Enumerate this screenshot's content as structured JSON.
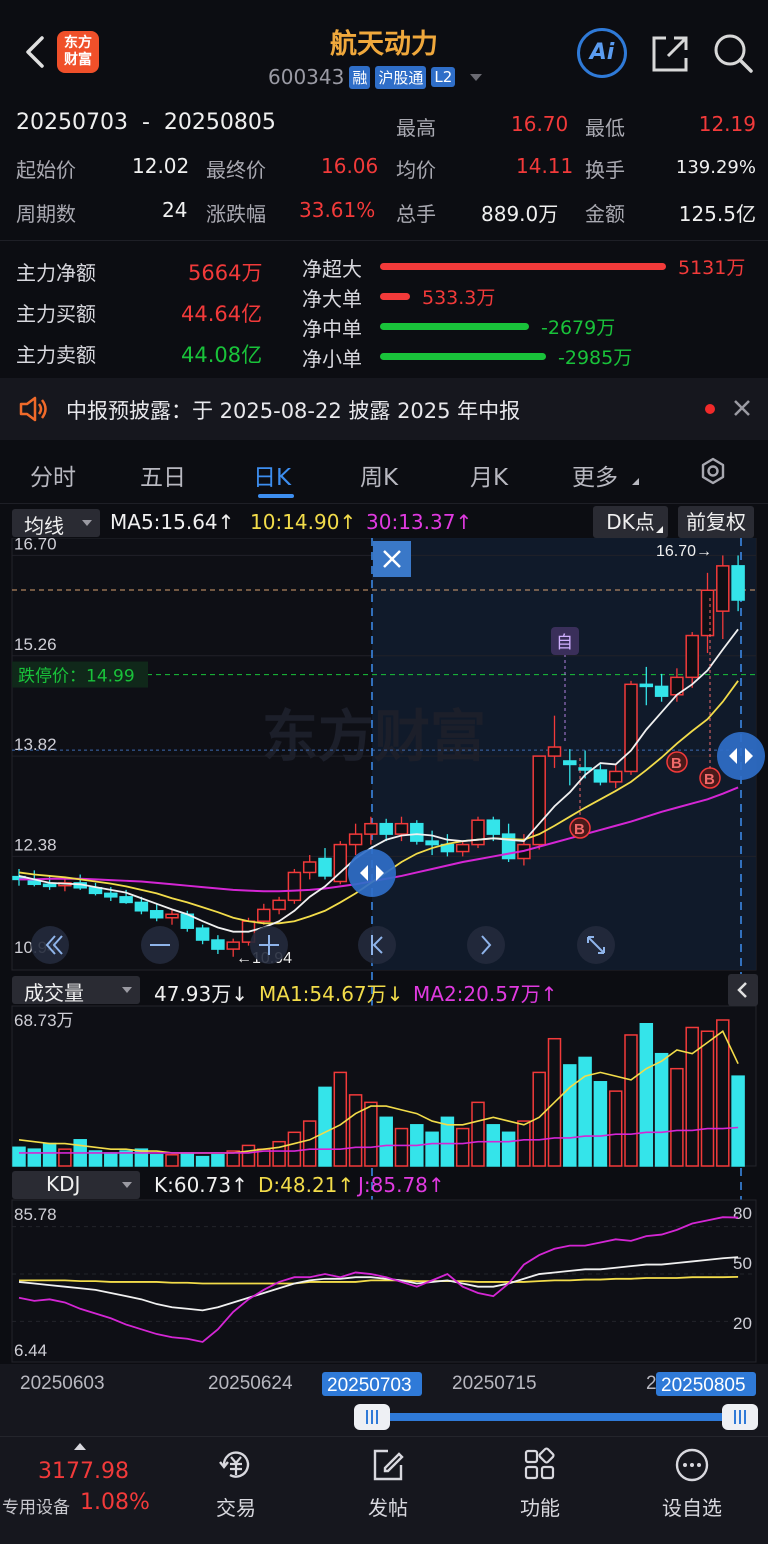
{
  "header": {
    "title": "航天动力",
    "code": "600343",
    "badge_rong": "融",
    "badge_hgt": "沪股通",
    "badge_l2": "L2",
    "logo_text_1": "东方",
    "logo_text_2": "财富",
    "ai_label": "Ai"
  },
  "range": {
    "label": "20250703  -  20250805"
  },
  "stats": {
    "high_label": "最高",
    "high": "16.70",
    "low_label": "最低",
    "low": "12.19",
    "start_label": "起始价",
    "start": "12.02",
    "end_label": "最终价",
    "end": "16.06",
    "avg_label": "均价",
    "avg": "14.11",
    "turnover_label": "换手",
    "turnover": "139.29%",
    "periods_label": "周期数",
    "periods": "24",
    "change_label": "涨跌幅",
    "change": "33.61%",
    "vol_label": "总手",
    "vol": "889.0万",
    "amount_label": "金额",
    "amount": "125.5亿"
  },
  "fund": {
    "net_label": "主力净额",
    "net": "5664万",
    "buy_label": "主力买额",
    "buy": "44.64亿",
    "sell_label": "主力卖额",
    "sell": "44.08亿",
    "flows": [
      {
        "label": "净超大",
        "value": "5131万",
        "ratio": 1.0,
        "color": "#f23a3a"
      },
      {
        "label": "净大单",
        "value": "533.3万",
        "ratio": 0.104,
        "color": "#f23a3a"
      },
      {
        "label": "净中单",
        "value": "-2679万",
        "ratio": 0.52,
        "color": "#19c23a"
      },
      {
        "label": "净小单",
        "value": "-2985万",
        "ratio": 0.58,
        "color": "#19c23a"
      }
    ]
  },
  "notice": {
    "text": "中报预披露：于 2025-08-22 披露 2025 年中报"
  },
  "tabs": [
    "分时",
    "五日",
    "日K",
    "周K",
    "月K",
    "更多"
  ],
  "ma": {
    "selector": "均线",
    "ma5": "MA5:15.64",
    "ma10": "10:14.90",
    "ma30": "30:13.37",
    "dk": "DK点",
    "fq": "前复权"
  },
  "price_axis": {
    "p1": "16.70",
    "p2": "15.26",
    "p3": "13.82",
    "p4": "12.38",
    "p5": "10.94",
    "limit": "跌停价：14.99",
    "max_mark": "16.70",
    "min_mark": "10.94",
    "zi": "自",
    "b": "B"
  },
  "volume": {
    "selector": "成交量",
    "v": "47.93万",
    "ma1": "MA1:54.67万",
    "ma2": "MA2:20.57万",
    "top": "68.73万"
  },
  "kdj": {
    "selector": "KDJ",
    "k": "K:60.73",
    "d": "D:48.21",
    "j": "J:85.78",
    "top": "85.78",
    "bottom": "6.44",
    "r80": "80",
    "r50": "50",
    "r20": "20"
  },
  "dates": {
    "d1": "20250603",
    "d2": "20250624",
    "d3": "20250703",
    "d4": "20250715",
    "d5": "20250805",
    "d5_partial": "2"
  },
  "watermark": "东方财富",
  "bottom": {
    "index": "3177.98",
    "index_change": "1.08%",
    "device": "专用设备",
    "trade": "交易",
    "post": "发帖",
    "func": "功能",
    "self": "设自选"
  },
  "chart_data": {
    "type": "candlestick",
    "ohlc": [
      [
        12.09,
        12.2,
        11.96,
        12.05
      ],
      [
        12.05,
        12.18,
        11.95,
        11.98
      ],
      [
        11.98,
        12.1,
        11.9,
        11.95
      ],
      [
        11.96,
        12.05,
        11.88,
        12.0
      ],
      [
        12.0,
        12.12,
        11.9,
        11.93
      ],
      [
        11.93,
        12.0,
        11.82,
        11.85
      ],
      [
        11.85,
        11.94,
        11.74,
        11.8
      ],
      [
        11.8,
        11.9,
        11.7,
        11.72
      ],
      [
        11.72,
        11.8,
        11.55,
        11.6
      ],
      [
        11.6,
        11.7,
        11.45,
        11.5
      ],
      [
        11.5,
        11.62,
        11.4,
        11.55
      ],
      [
        11.55,
        11.6,
        11.3,
        11.35
      ],
      [
        11.35,
        11.4,
        11.12,
        11.18
      ],
      [
        11.18,
        11.25,
        10.98,
        11.05
      ],
      [
        11.05,
        11.2,
        10.94,
        11.15
      ],
      [
        11.15,
        11.5,
        11.1,
        11.45
      ],
      [
        11.45,
        11.7,
        11.4,
        11.62
      ],
      [
        11.62,
        11.8,
        11.55,
        11.75
      ],
      [
        11.75,
        12.2,
        11.7,
        12.15
      ],
      [
        12.15,
        12.4,
        12.05,
        12.3
      ],
      [
        12.35,
        12.5,
        12.05,
        12.1
      ],
      [
        12.02,
        12.6,
        11.98,
        12.55
      ],
      [
        12.55,
        12.85,
        12.4,
        12.7
      ],
      [
        12.7,
        12.95,
        12.55,
        12.85
      ],
      [
        12.85,
        12.92,
        12.6,
        12.7
      ],
      [
        12.7,
        12.95,
        12.6,
        12.85
      ],
      [
        12.85,
        12.9,
        12.55,
        12.6
      ],
      [
        12.6,
        12.75,
        12.4,
        12.55
      ],
      [
        12.55,
        12.7,
        12.38,
        12.45
      ],
      [
        12.45,
        12.6,
        12.38,
        12.55
      ],
      [
        12.55,
        12.95,
        12.5,
        12.9
      ],
      [
        12.9,
        12.95,
        12.6,
        12.7
      ],
      [
        12.7,
        12.85,
        12.3,
        12.35
      ],
      [
        12.35,
        12.7,
        12.25,
        12.55
      ],
      [
        12.55,
        13.82,
        12.48,
        13.82
      ],
      [
        13.82,
        14.4,
        13.65,
        13.95
      ],
      [
        13.75,
        13.92,
        13.4,
        13.7
      ],
      [
        13.65,
        13.9,
        13.5,
        13.62
      ],
      [
        13.62,
        13.7,
        13.4,
        13.45
      ],
      [
        13.45,
        13.7,
        13.36,
        13.6
      ],
      [
        13.6,
        14.9,
        13.55,
        14.85
      ],
      [
        14.85,
        15.1,
        14.55,
        14.82
      ],
      [
        14.82,
        15.0,
        14.6,
        14.68
      ],
      [
        14.7,
        15.08,
        14.6,
        14.95
      ],
      [
        14.95,
        15.6,
        14.8,
        15.55
      ],
      [
        15.55,
        16.45,
        15.3,
        16.2
      ],
      [
        15.9,
        16.7,
        15.5,
        16.55
      ],
      [
        16.55,
        16.7,
        15.9,
        16.06
      ]
    ],
    "ma5": [
      12.1,
      12.05,
      12.0,
      11.99,
      11.98,
      11.94,
      11.9,
      11.86,
      11.78,
      11.7,
      11.62,
      11.55,
      11.45,
      11.36,
      11.3,
      11.3,
      11.36,
      11.45,
      11.6,
      11.8,
      11.95,
      12.15,
      12.35,
      12.5,
      12.62,
      12.68,
      12.7,
      12.68,
      12.62,
      12.6,
      12.62,
      12.64,
      12.62,
      12.6,
      12.85,
      13.1,
      13.3,
      13.55,
      13.72,
      13.7,
      13.9,
      14.2,
      14.45,
      14.7,
      14.85,
      15.05,
      15.35,
      15.64
    ],
    "ma10": [
      12.15,
      12.12,
      12.1,
      12.08,
      12.05,
      12.02,
      11.99,
      11.95,
      11.9,
      11.85,
      11.78,
      11.72,
      11.65,
      11.58,
      11.5,
      11.45,
      11.42,
      11.42,
      11.45,
      11.52,
      11.6,
      11.72,
      11.85,
      12.0,
      12.15,
      12.3,
      12.42,
      12.5,
      12.56,
      12.6,
      12.62,
      12.64,
      12.63,
      12.62,
      12.7,
      12.82,
      12.95,
      13.08,
      13.2,
      13.32,
      13.45,
      13.62,
      13.8,
      14.0,
      14.18,
      14.35,
      14.6,
      14.9
    ],
    "ma30": [
      12.05,
      12.05,
      12.06,
      12.06,
      12.06,
      12.05,
      12.04,
      12.03,
      12.02,
      12.0,
      11.98,
      11.96,
      11.94,
      11.92,
      11.9,
      11.89,
      11.88,
      11.88,
      11.89,
      11.9,
      11.92,
      11.95,
      11.98,
      12.02,
      12.06,
      12.1,
      12.15,
      12.2,
      12.25,
      12.3,
      12.34,
      12.38,
      12.42,
      12.46,
      12.52,
      12.58,
      12.64,
      12.7,
      12.76,
      12.82,
      12.88,
      12.95,
      13.02,
      13.08,
      13.14,
      13.2,
      13.28,
      13.37
    ],
    "volume_wan": [
      10,
      9,
      12,
      9,
      14,
      8,
      7,
      8,
      9,
      6,
      6,
      7,
      5,
      6,
      8,
      11,
      9,
      13,
      18,
      24,
      42,
      50,
      38,
      34,
      26,
      20,
      22,
      18,
      26,
      20,
      34,
      22,
      18,
      24,
      50,
      68,
      54,
      58,
      45,
      40,
      70,
      76,
      60,
      52,
      74,
      72,
      78,
      48
    ],
    "volume_ma1": [
      14,
      13,
      12,
      12,
      11,
      10,
      9,
      9,
      8,
      8,
      7,
      7,
      7,
      7,
      7,
      8,
      9,
      10,
      12,
      14,
      18,
      22,
      28,
      32,
      32,
      30,
      28,
      24,
      22,
      22,
      24,
      26,
      24,
      22,
      26,
      34,
      42,
      48,
      50,
      48,
      46,
      52,
      56,
      62,
      60,
      66,
      72,
      54.67
    ],
    "volume_ma2": [
      7,
      7,
      7,
      7,
      7,
      7,
      7,
      7,
      7,
      7,
      7,
      7,
      7,
      7,
      7,
      7,
      8,
      8,
      8,
      9,
      9,
      9,
      10,
      10,
      11,
      11,
      11,
      12,
      12,
      12,
      13,
      13,
      13,
      14,
      14,
      15,
      15,
      16,
      16,
      17,
      17,
      18,
      18,
      19,
      19,
      20,
      20,
      20.57
    ],
    "k": [
      45,
      44,
      43,
      42,
      41,
      40,
      38,
      36,
      34,
      31,
      29,
      28,
      27,
      29,
      32,
      35,
      38,
      41,
      44,
      46,
      47,
      47,
      48,
      48,
      47,
      46,
      44,
      45,
      46,
      44,
      42,
      42,
      44,
      47,
      50,
      51,
      52,
      53,
      53,
      54,
      55,
      56,
      56,
      57,
      58,
      59,
      60,
      60.73
    ],
    "d": [
      46,
      46,
      46,
      46,
      45.5,
      45.5,
      45,
      45,
      45,
      45,
      44.5,
      44.5,
      44,
      44,
      44,
      44,
      44,
      44,
      44,
      45,
      45,
      45,
      45,
      46,
      46,
      46,
      45.5,
      45.5,
      45.5,
      45.5,
      45,
      45,
      45,
      45,
      45.5,
      46,
      46,
      46.5,
      46.5,
      47,
      47,
      47.5,
      47.5,
      47.5,
      48,
      48,
      48,
      48.21
    ],
    "j": [
      35,
      33,
      34,
      32,
      28,
      25,
      22,
      18,
      15,
      12,
      10,
      9,
      7,
      15,
      26,
      34,
      40,
      45,
      48,
      48,
      50,
      48,
      51,
      50,
      48,
      45,
      42,
      46,
      50,
      42,
      38,
      36,
      44,
      56,
      62,
      66,
      68,
      68,
      70,
      72,
      71,
      74,
      75,
      78,
      82,
      84,
      86,
      85.78
    ]
  }
}
